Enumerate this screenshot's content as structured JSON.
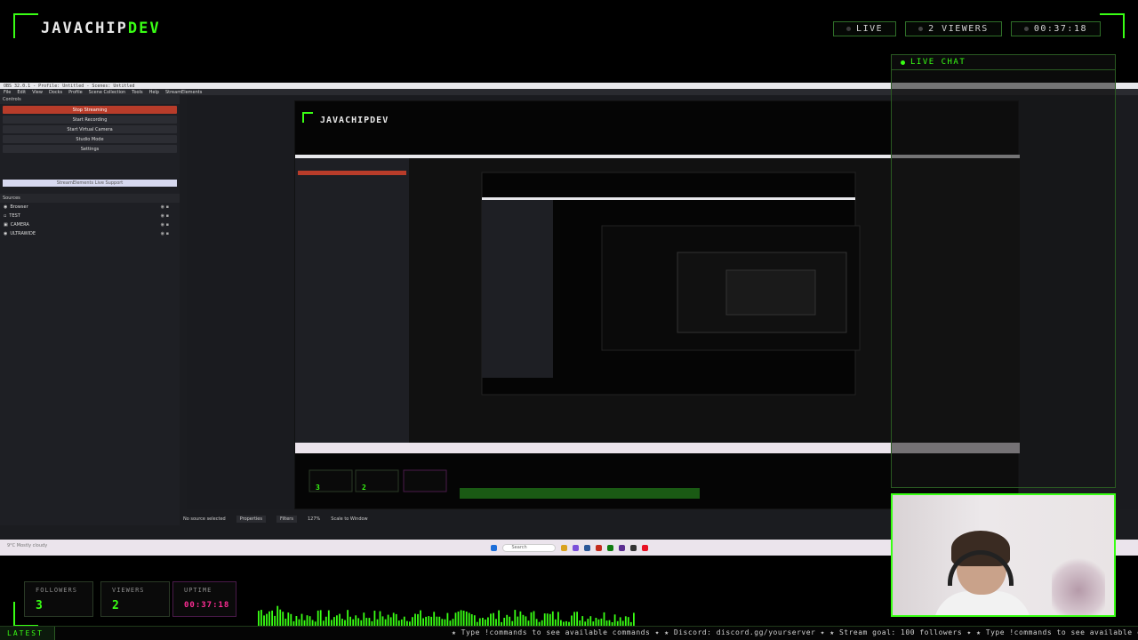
{
  "overlay": {
    "brand_main": "JAVACHIP",
    "brand_accent": "DEV",
    "status": {
      "live_label": "LIVE",
      "viewers_label": "2 VIEWERS",
      "uptime": "00:37:18"
    },
    "chat_title": "LIVE CHAT",
    "stats": {
      "followers_label": "FOLLOWERS",
      "followers_value": "3",
      "viewers_label": "VIEWERS",
      "viewers_value": "2",
      "uptime_label": "UPTIME",
      "uptime_value": "00:37:18"
    },
    "latest_label": "LATEST",
    "ticker": "★ Type !commands to see available commands ✦ ★ Discord: discord.gg/yourserver ✦ ★ Stream goal: 100 followers ✦ ★ Type !commands to see available commands ✦ ★",
    "accent_color": "#39ff14",
    "uptime_color": "#ff2d95"
  },
  "obs": {
    "window_title": "OBS 32.0.1 - Profile: Untitled - Scenes: Untitled",
    "menu": [
      "File",
      "Edit",
      "View",
      "Docks",
      "Profile",
      "Scene Collection",
      "Tools",
      "Help",
      "StreamElements"
    ],
    "controls_title": "Controls",
    "controls": {
      "stop_streaming": "Stop Streaming",
      "start_recording": "Start Recording",
      "start_virtual_camera": "Start Virtual Camera",
      "studio_mode": "Studio Mode",
      "settings": "Settings"
    },
    "se_live_support": "StreamElements Live Support",
    "sources_title": "Sources",
    "sources": [
      "Browser",
      "TEST",
      "CAMERA",
      "ULTRAWIDE"
    ],
    "bottom": {
      "zoom": "127%",
      "scale": "Scale to Window",
      "no_source": "No source selected",
      "properties": "Properties",
      "filters": "Filters"
    },
    "taskbar_search": "Search",
    "weather_temp": "9°C",
    "weather_desc": "Mostly cloudy"
  }
}
